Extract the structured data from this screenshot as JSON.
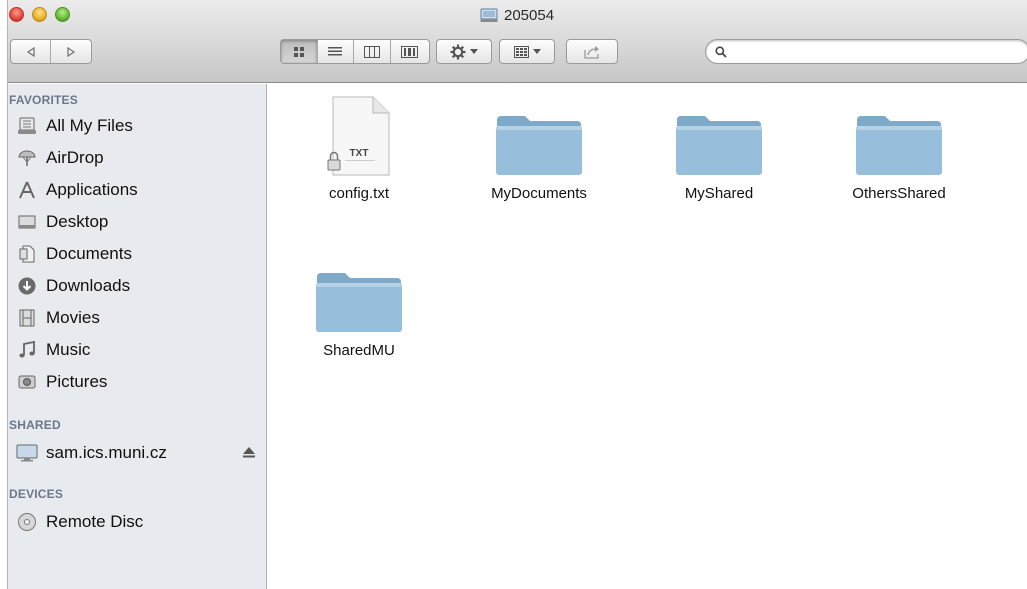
{
  "window": {
    "title": "205054"
  },
  "toolbar": {
    "search_placeholder": ""
  },
  "sidebar": {
    "favorites_header": "FAVORITES",
    "favorites": [
      {
        "label": "All My Files",
        "icon": "all-files-icon"
      },
      {
        "label": "AirDrop",
        "icon": "airdrop-icon"
      },
      {
        "label": "Applications",
        "icon": "applications-icon"
      },
      {
        "label": "Desktop",
        "icon": "desktop-icon"
      },
      {
        "label": "Documents",
        "icon": "documents-icon"
      },
      {
        "label": "Downloads",
        "icon": "downloads-icon"
      },
      {
        "label": "Movies",
        "icon": "movies-icon"
      },
      {
        "label": "Music",
        "icon": "music-icon"
      },
      {
        "label": "Pictures",
        "icon": "pictures-icon"
      }
    ],
    "shared_header": "SHARED",
    "shared": [
      {
        "label": "sam.ics.muni.cz",
        "icon": "network-server-icon"
      }
    ],
    "devices_header": "DEVICES",
    "devices": [
      {
        "label": "Remote Disc",
        "icon": "remote-disc-icon"
      }
    ]
  },
  "content": {
    "items": [
      {
        "label": "config.txt",
        "kind": "text-file",
        "badge": "TXT"
      },
      {
        "label": "MyDocuments",
        "kind": "folder"
      },
      {
        "label": "MyShared",
        "kind": "folder"
      },
      {
        "label": "OthersShared",
        "kind": "folder"
      },
      {
        "label": "SharedMU",
        "kind": "folder"
      }
    ]
  },
  "colors": {
    "sidebar_bg": "#e7eaef",
    "section_header": "#6c7787",
    "folder_blue": "#8fb6d3"
  }
}
